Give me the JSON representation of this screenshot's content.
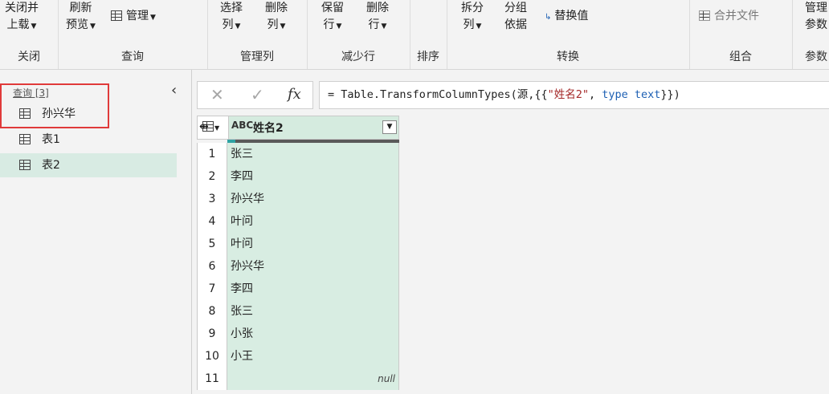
{
  "ribbon": {
    "groups": {
      "close": "关闭",
      "query": "查询",
      "manage_columns": "管理列",
      "reduce_rows": "减少行",
      "sort": "排序",
      "transform": "转换",
      "combine": "组合",
      "parameters": "参数"
    },
    "close_load": {
      "line1": "关闭并",
      "line2": "上载"
    },
    "refresh_preview": {
      "line1": "刷新",
      "line2": "预览"
    },
    "manage": "管理",
    "choose_columns": {
      "line1": "选择",
      "line2": "列"
    },
    "remove_columns": {
      "line1": "删除",
      "line2": "列"
    },
    "keep_rows": {
      "line1": "保留",
      "line2": "行"
    },
    "remove_rows": {
      "line1": "删除",
      "line2": "行"
    },
    "split_column": {
      "line1": "拆分",
      "line2": "列"
    },
    "group_by": {
      "line1": "分组",
      "line2": "依据"
    },
    "replace_values": "替换值",
    "merge_files": "合并文件",
    "manage_params": {
      "line1": "管理",
      "line2": "参数"
    }
  },
  "queries": {
    "header": "查询 [3]",
    "items": [
      {
        "label": "孙兴华",
        "selected": false
      },
      {
        "label": "表1",
        "selected": false
      },
      {
        "label": "表2",
        "selected": true
      }
    ]
  },
  "formula": {
    "cancel": "✕",
    "commit": "✓",
    "fx": "fx",
    "prefix": "= Table.TransformColumnTypes(源,{{",
    "string1": "\"姓名2\"",
    "comma": ", ",
    "keyword": "type",
    "type": " text",
    "suffix": "}})"
  },
  "grid": {
    "type_icon": "ABC",
    "column_name": "姓名2",
    "rows": [
      {
        "n": "1",
        "v": "张三"
      },
      {
        "n": "2",
        "v": "李四"
      },
      {
        "n": "3",
        "v": "孙兴华"
      },
      {
        "n": "4",
        "v": "叶问"
      },
      {
        "n": "5",
        "v": "叶问"
      },
      {
        "n": "6",
        "v": "孙兴华"
      },
      {
        "n": "7",
        "v": "李四"
      },
      {
        "n": "8",
        "v": "张三"
      },
      {
        "n": "9",
        "v": "小张"
      },
      {
        "n": "10",
        "v": "小王"
      },
      {
        "n": "11",
        "v": "null"
      }
    ]
  }
}
